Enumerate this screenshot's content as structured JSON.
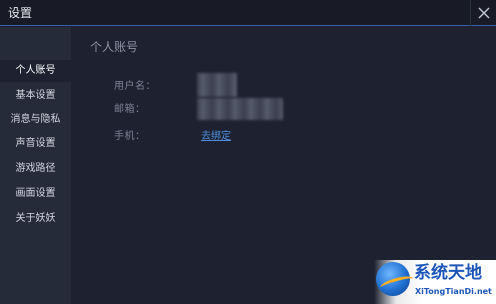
{
  "window": {
    "title": "设置"
  },
  "sidebar": {
    "items": [
      {
        "label": "个人账号",
        "active": true
      },
      {
        "label": "基本设置",
        "active": false
      },
      {
        "label": "消息与隐私",
        "active": false
      },
      {
        "label": "声音设置",
        "active": false
      },
      {
        "label": "游戏路径",
        "active": false
      },
      {
        "label": "画面设置",
        "active": false
      },
      {
        "label": "关于妖妖",
        "active": false
      }
    ]
  },
  "main": {
    "section_title": "个人账号",
    "fields": {
      "username_label": "用户名：",
      "email_label": "邮箱：",
      "phone_label": "手机：",
      "phone_link": "去绑定"
    }
  },
  "watermark": {
    "name_cn": "系统天地",
    "name_en": "XiTongTianDi.net"
  },
  "colors": {
    "background": "#1e2230",
    "sidebar": "#262b3a",
    "titlebar": "#181b26",
    "accent_border": "#3a5fa8",
    "link": "#4f8fe0"
  }
}
